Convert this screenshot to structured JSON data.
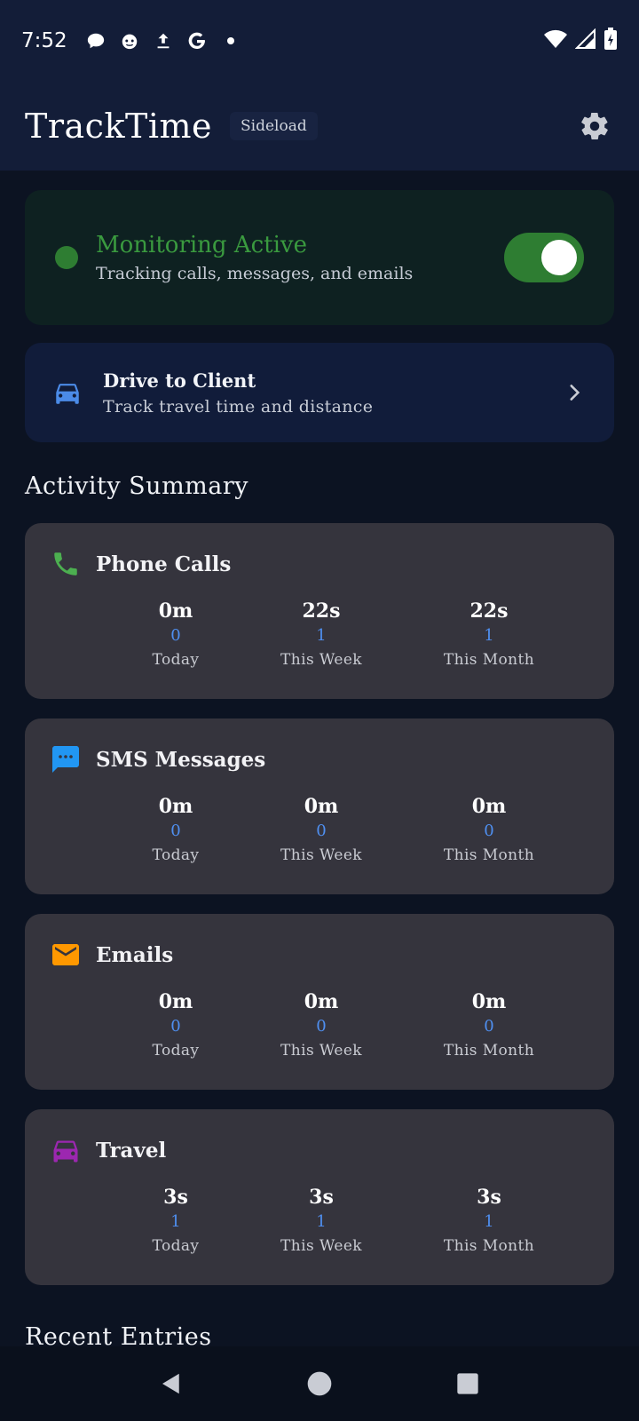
{
  "status_bar": {
    "time": "7:52",
    "icons": [
      "chat-bubble-icon",
      "cat-face-icon",
      "upload-icon",
      "google-icon",
      "dot-icon"
    ],
    "right_icons": [
      "wifi-icon",
      "signal-icon",
      "battery-charging-icon"
    ]
  },
  "app_bar": {
    "title": "TrackTime",
    "badge": "Sideload",
    "settings_icon": "gear-icon"
  },
  "monitoring": {
    "title": "Monitoring Active",
    "subtitle": "Tracking calls, messages, and emails",
    "enabled": true,
    "accent": "#2e7d32"
  },
  "drive": {
    "title": "Drive to Client",
    "subtitle": "Track travel time and distance",
    "icon": "car-icon"
  },
  "summary": {
    "title": "Activity Summary",
    "cards": [
      {
        "title": "Phone Calls",
        "icon": "phone-icon",
        "color": "#4caf50",
        "stats": [
          {
            "value": "0m",
            "count": "0",
            "label": "Today"
          },
          {
            "value": "22s",
            "count": "1",
            "label": "This Week"
          },
          {
            "value": "22s",
            "count": "1",
            "label": "This Month"
          }
        ]
      },
      {
        "title": "SMS Messages",
        "icon": "message-icon",
        "color": "#2196f3",
        "stats": [
          {
            "value": "0m",
            "count": "0",
            "label": "Today"
          },
          {
            "value": "0m",
            "count": "0",
            "label": "This Week"
          },
          {
            "value": "0m",
            "count": "0",
            "label": "This Month"
          }
        ]
      },
      {
        "title": "Emails",
        "icon": "mail-icon",
        "color": "#ff9800",
        "stats": [
          {
            "value": "0m",
            "count": "0",
            "label": "Today"
          },
          {
            "value": "0m",
            "count": "0",
            "label": "This Week"
          },
          {
            "value": "0m",
            "count": "0",
            "label": "This Month"
          }
        ]
      },
      {
        "title": "Travel",
        "icon": "car-icon",
        "color": "#9c27b0",
        "stats": [
          {
            "value": "3s",
            "count": "1",
            "label": "Today"
          },
          {
            "value": "3s",
            "count": "1",
            "label": "This Week"
          },
          {
            "value": "3s",
            "count": "1",
            "label": "This Month"
          }
        ]
      }
    ]
  },
  "recent": {
    "title": "Recent Entries"
  },
  "nav_bar": {
    "icons": [
      "back-icon",
      "home-icon",
      "recents-icon"
    ]
  }
}
